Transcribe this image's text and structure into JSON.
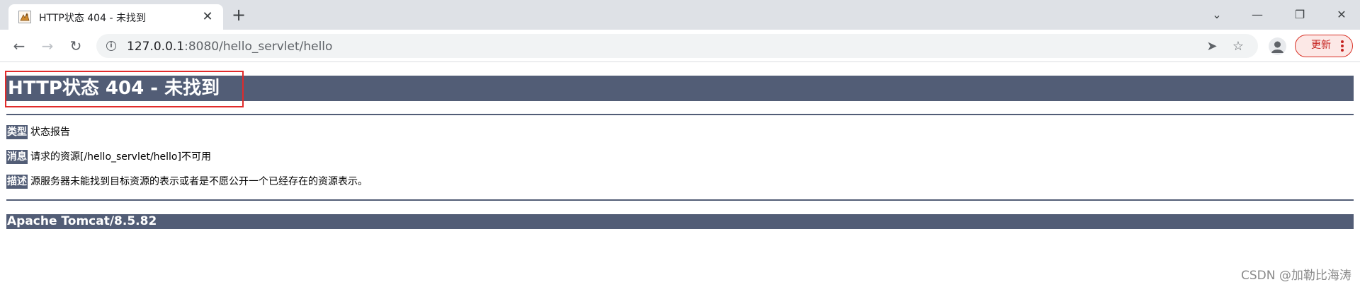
{
  "browser": {
    "tab": {
      "title": "HTTP状态 404 - 未找到",
      "favicon": "tomcat-icon",
      "close_glyph": "✕"
    },
    "new_tab_glyph": "+",
    "window_controls": {
      "tab_search_glyph": "⌄",
      "minimize_glyph": "—",
      "restore_glyph": "❐",
      "close_glyph": "✕"
    },
    "toolbar": {
      "back_glyph": "←",
      "forward_glyph": "→",
      "reload_glyph": "↻",
      "info_glyph": "i",
      "url_host": "127.0.0.1",
      "url_rest": ":8080/hello_servlet/hello",
      "send_glyph": "➤",
      "star_glyph": "☆",
      "update_label": "更新"
    }
  },
  "page": {
    "heading": "HTTP状态 404 - 未找到",
    "rows": [
      {
        "label": "类型",
        "text": "状态报告"
      },
      {
        "label": "消息",
        "text": "请求的资源[/hello_servlet/hello]不可用"
      },
      {
        "label": "描述",
        "text": "源服务器未能找到目标资源的表示或者是不愿公开一个已经存在的资源表示。"
      }
    ],
    "footer": "Apache Tomcat/8.5.82"
  },
  "watermark": "CSDN @加勒比海涛",
  "colors": {
    "tomcat_bar": "#525d76",
    "highlight_border": "#e02b2b",
    "update_button": "#c5221f"
  }
}
